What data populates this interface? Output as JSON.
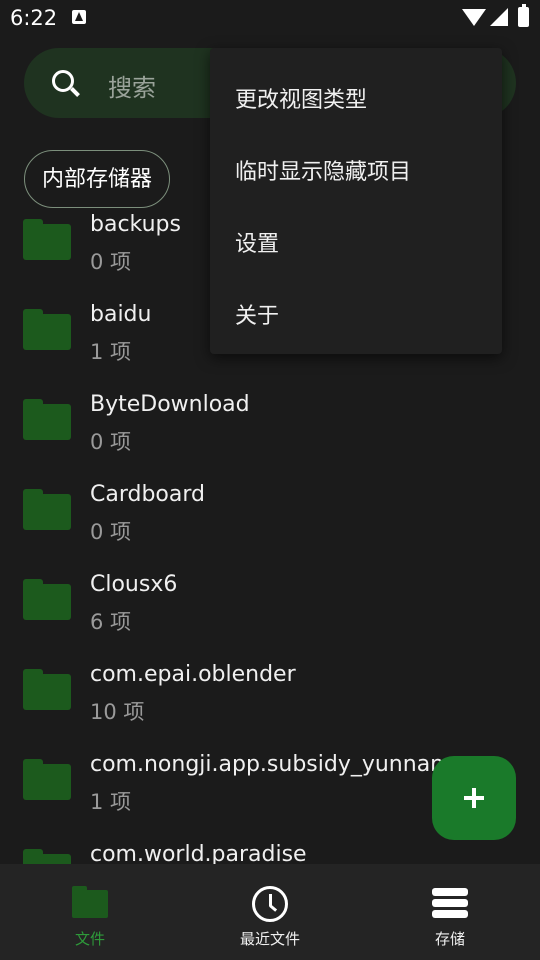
{
  "status_bar": {
    "time": "6:22"
  },
  "search": {
    "placeholder": "搜索"
  },
  "location_chip": "内部存储器",
  "files": [
    {
      "name": "backups",
      "count": "0 项"
    },
    {
      "name": "baidu",
      "count": "1 项"
    },
    {
      "name": "ByteDownload",
      "count": "0 项"
    },
    {
      "name": "Cardboard",
      "count": "0 项"
    },
    {
      "name": "Clousx6",
      "count": "6 项"
    },
    {
      "name": "com.epai.oblender",
      "count": "10 项"
    },
    {
      "name": "com.nongji.app.subsidy_yunnan",
      "count": "1 项"
    },
    {
      "name": "com.world.paradise",
      "count": ""
    }
  ],
  "menu": {
    "items": [
      "更改视图类型",
      "临时显示隐藏项目",
      "设置",
      "关于"
    ]
  },
  "bottom_nav": {
    "items": [
      {
        "label": "文件",
        "icon": "folder-icon",
        "active": true
      },
      {
        "label": "最近文件",
        "icon": "clock-icon",
        "active": false
      },
      {
        "label": "存储",
        "icon": "storage-icon",
        "active": false
      }
    ]
  },
  "colors": {
    "accent": "#1a7a2a",
    "folder": "#1c5a1d",
    "active_label": "#2e9a3a"
  }
}
